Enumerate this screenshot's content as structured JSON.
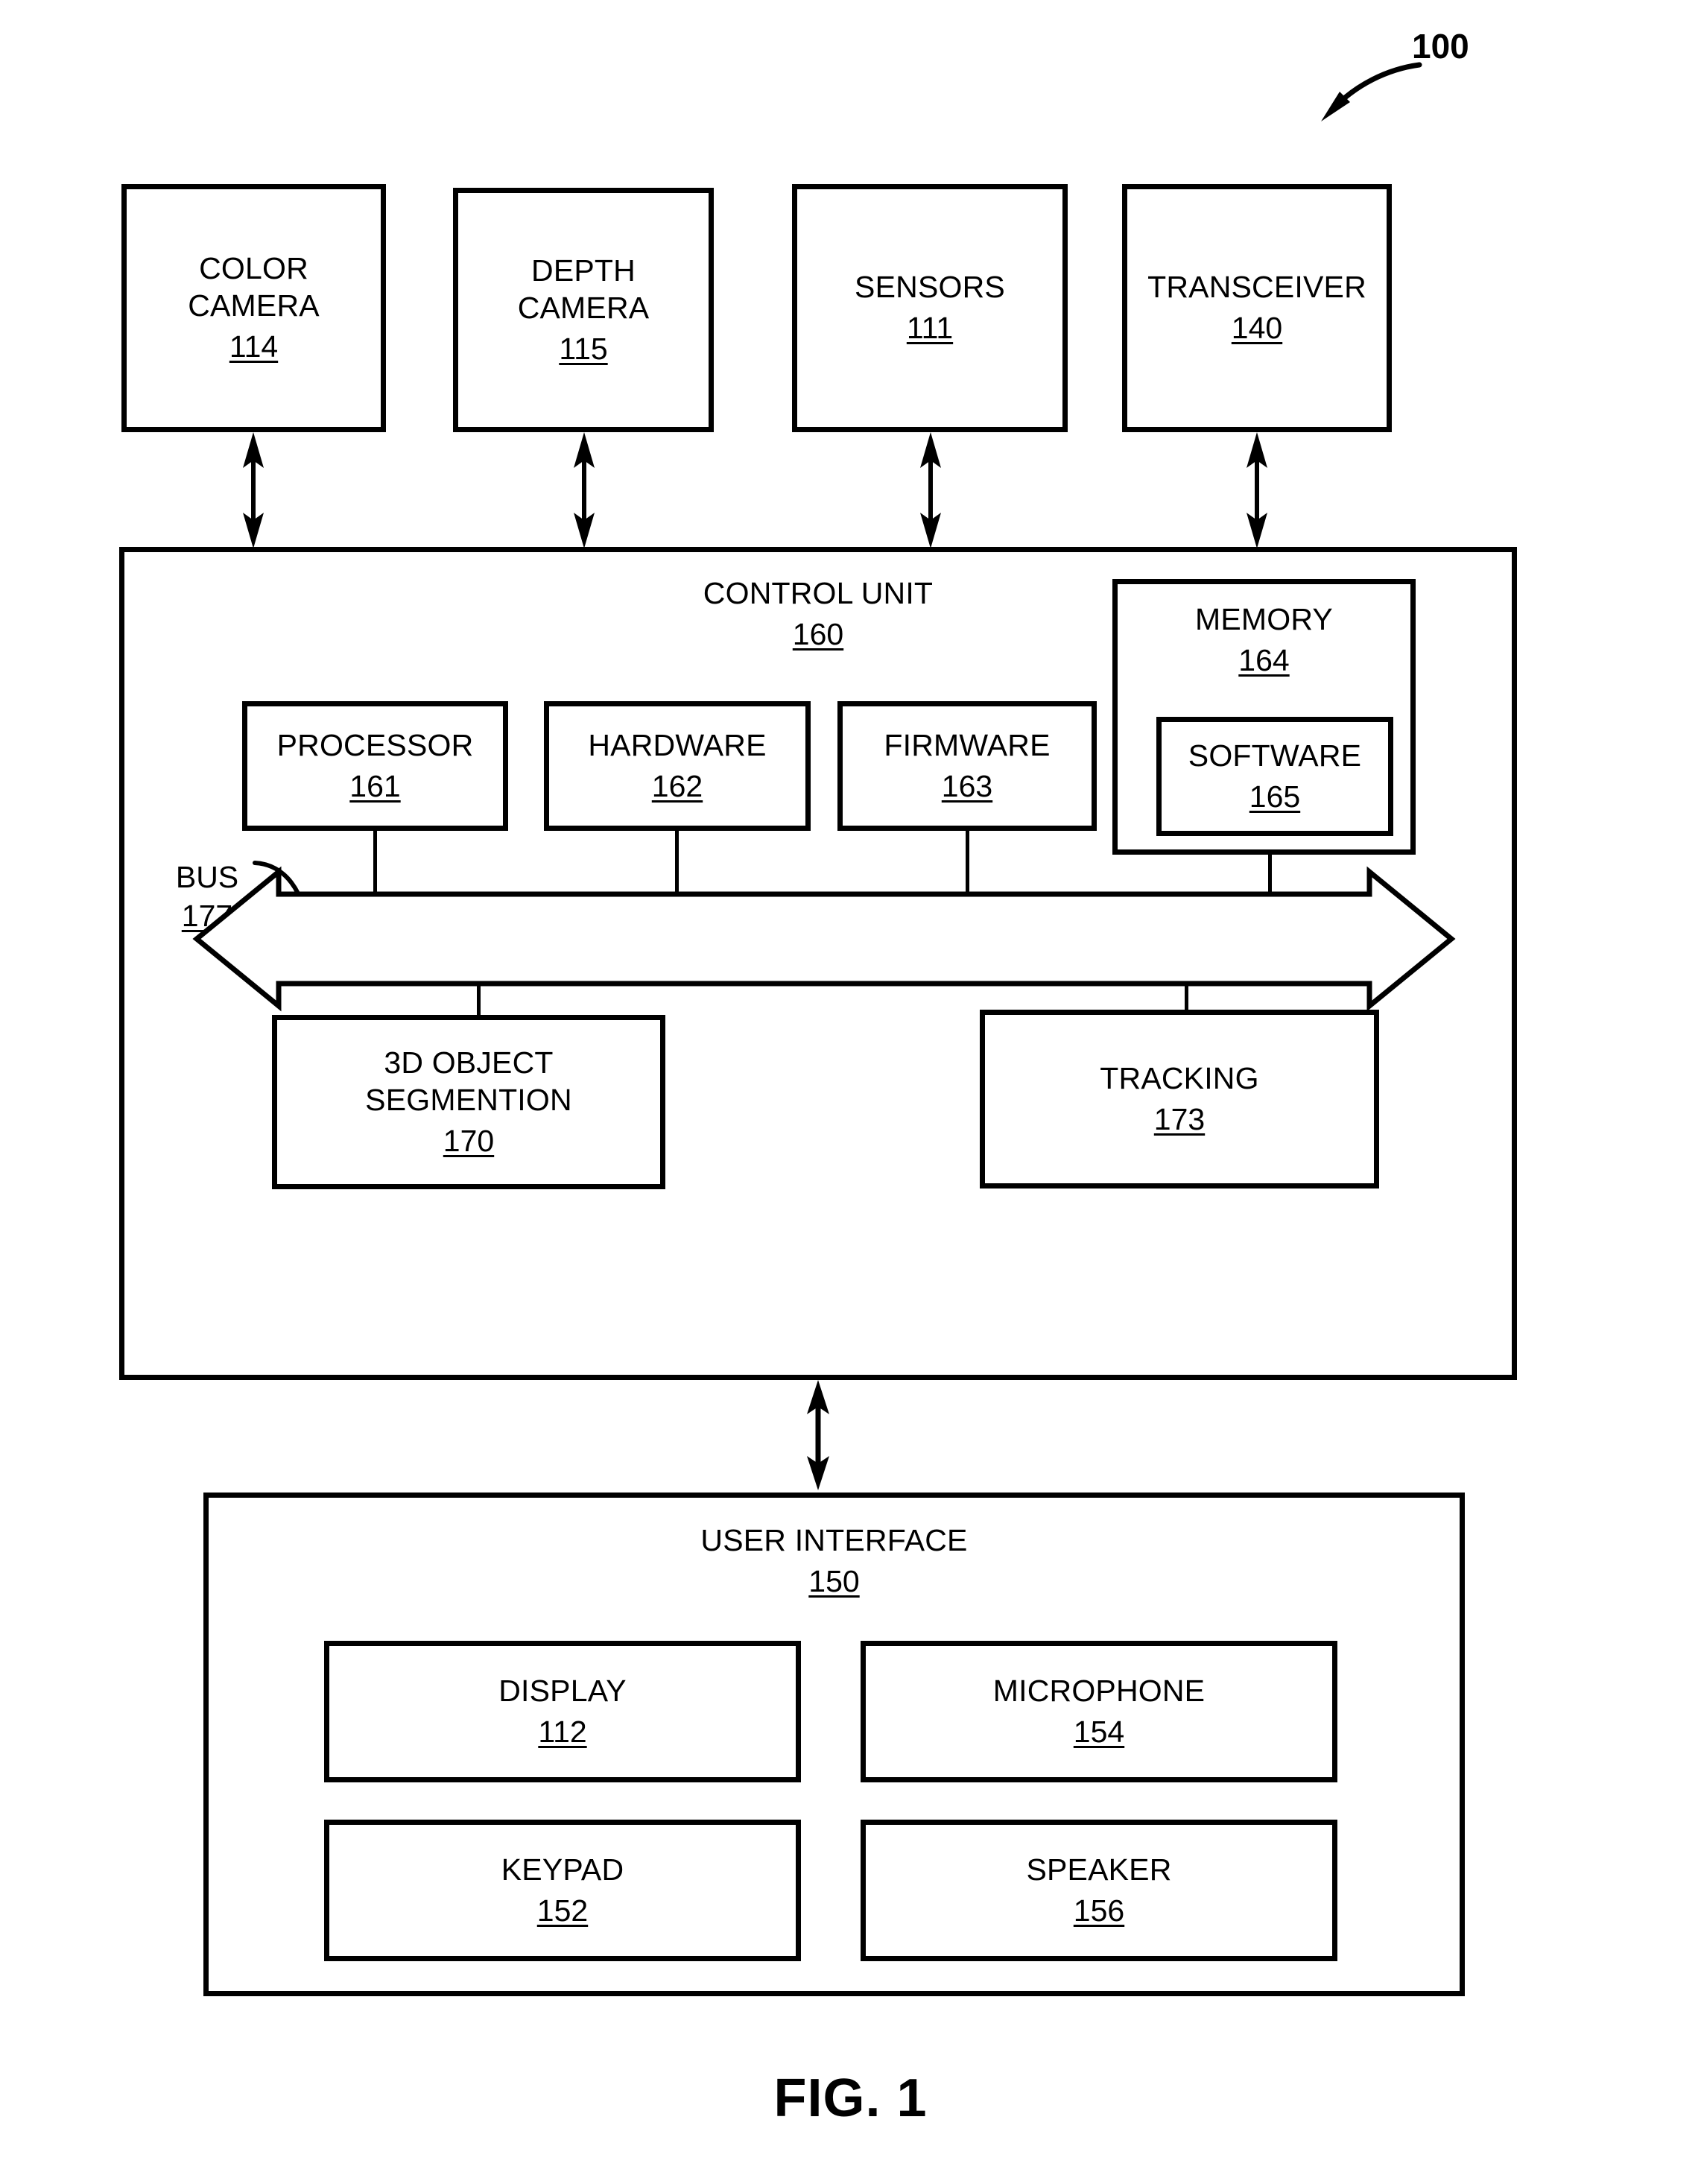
{
  "figure": {
    "caption": "FIG. 1",
    "ref_numeral": "100"
  },
  "top_devices": [
    {
      "title": "COLOR\nCAMERA",
      "number": "114",
      "name": "color-camera"
    },
    {
      "title": "DEPTH\nCAMERA",
      "number": "115",
      "name": "depth-camera"
    },
    {
      "title": "SENSORS",
      "number": "111",
      "name": "sensors"
    },
    {
      "title": "TRANSCEIVER",
      "number": "140",
      "name": "transceiver"
    }
  ],
  "control_unit": {
    "title": "CONTROL UNIT",
    "number": "160",
    "bus": {
      "label": "BUS",
      "number": "177"
    },
    "upper_blocks": [
      {
        "title": "PROCESSOR",
        "number": "161",
        "name": "processor"
      },
      {
        "title": "HARDWARE",
        "number": "162",
        "name": "hardware"
      },
      {
        "title": "FIRMWARE",
        "number": "163",
        "name": "firmware"
      }
    ],
    "memory": {
      "title": "MEMORY",
      "number": "164",
      "software": {
        "title": "SOFTWARE",
        "number": "165"
      }
    },
    "lower_blocks": [
      {
        "title": "3D OBJECT\nSEGMENTION",
        "number": "170",
        "name": "3d-object-segmention"
      },
      {
        "title": "TRACKING",
        "number": "173",
        "name": "tracking"
      }
    ]
  },
  "user_interface": {
    "title": "USER INTERFACE",
    "number": "150",
    "blocks": [
      {
        "title": "DISPLAY",
        "number": "112",
        "name": "display"
      },
      {
        "title": "MICROPHONE",
        "number": "154",
        "name": "microphone"
      },
      {
        "title": "KEYPAD",
        "number": "152",
        "name": "keypad"
      },
      {
        "title": "SPEAKER",
        "number": "156",
        "name": "speaker"
      }
    ]
  },
  "colors": {
    "stroke": "#000000",
    "background": "#ffffff"
  }
}
